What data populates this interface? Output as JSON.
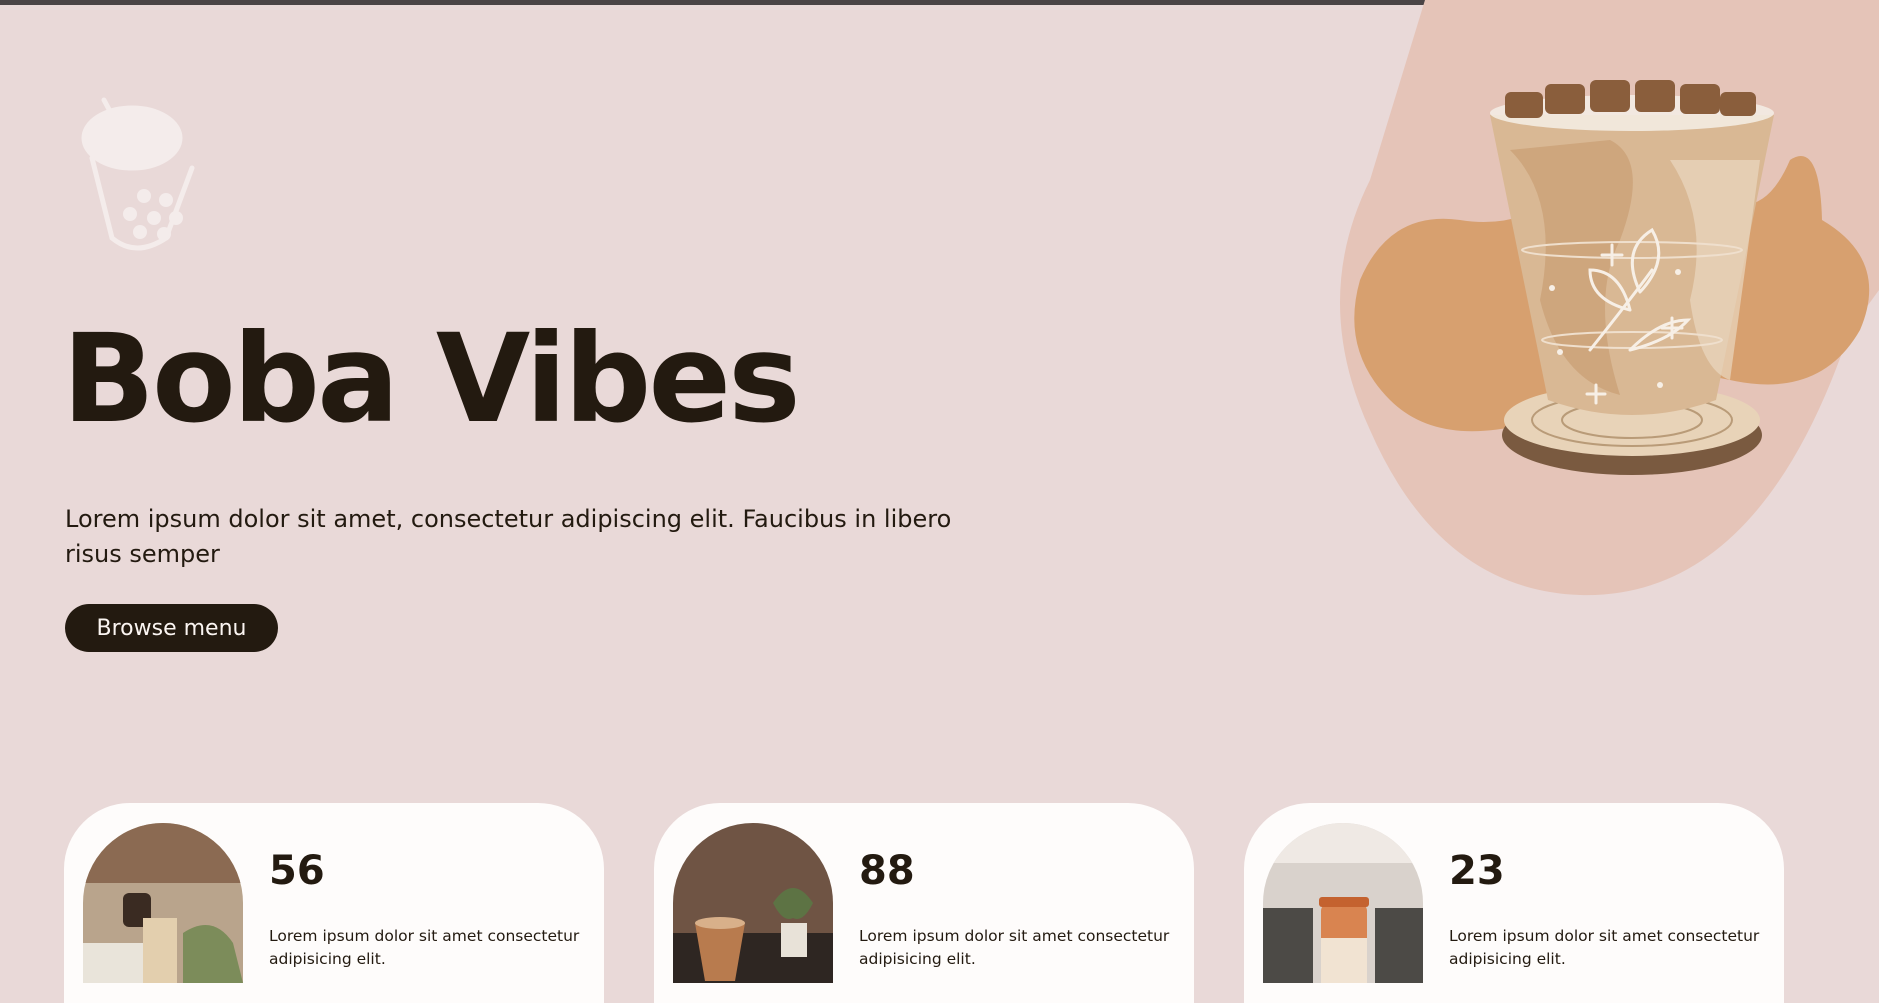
{
  "hero": {
    "title": "Boba Vibes",
    "description": "Lorem ipsum dolor sit amet, consectetur adipiscing elit. Faucibus in libero risus semper",
    "browse_label": "Browse menu"
  },
  "stats": [
    {
      "number": "56",
      "text": "Lorem ipsum dolor sit amet consectetur adipisicing elit."
    },
    {
      "number": "88",
      "text": "Lorem ipsum dolor sit amet consectetur adipisicing elit."
    },
    {
      "number": "23",
      "text": "Lorem ipsum dolor sit amet consectetur adipisicing elit."
    }
  ],
  "icons": {
    "logo": "boba-cup-icon",
    "hero_image": "iced-coffee-cup-icon"
  },
  "colors": {
    "background": "#e9d9d8",
    "dark": "#231a10",
    "blob_light": "#e5c4b8",
    "blob_dark": "#d7a06f",
    "card": "#fefcfb"
  }
}
